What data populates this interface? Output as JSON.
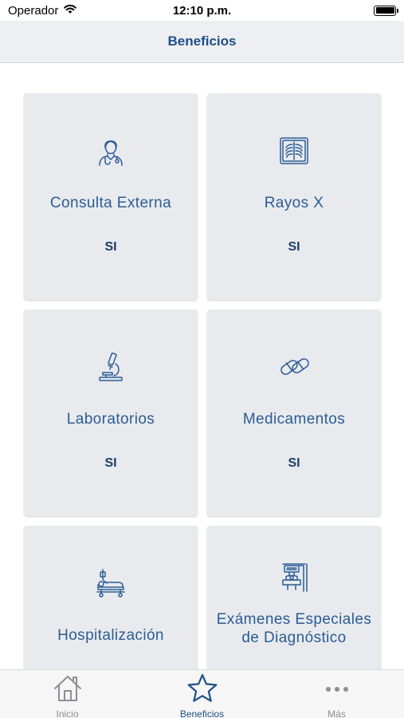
{
  "status_bar": {
    "carrier": "Operador",
    "time": "12:10 p.m."
  },
  "nav": {
    "title": "Beneficios"
  },
  "cards": [
    {
      "label": "Consulta Externa",
      "value": "SI",
      "icon": "doctor-icon"
    },
    {
      "label": "Rayos X",
      "value": "SI",
      "icon": "xray-icon"
    },
    {
      "label": "Laboratorios",
      "value": "SI",
      "icon": "microscope-icon"
    },
    {
      "label": "Medicamentos",
      "value": "SI",
      "icon": "pills-icon"
    },
    {
      "label": "Hospitalización",
      "value": "",
      "icon": "hospital-bed-icon"
    },
    {
      "label": "Exámenes Especiales de Diagnóstico",
      "value": "",
      "icon": "scanner-icon"
    }
  ],
  "tabs": [
    {
      "label": "Inicio",
      "icon": "home-icon",
      "active": false
    },
    {
      "label": "Beneficios",
      "icon": "star-icon",
      "active": true
    },
    {
      "label": "Más",
      "icon": "more-icon",
      "active": false
    }
  ],
  "colors": {
    "accent": "#1f4f86",
    "card_bg": "#e8eaee",
    "nav_bg": "#eeeff2",
    "inactive": "#8e8e93"
  }
}
